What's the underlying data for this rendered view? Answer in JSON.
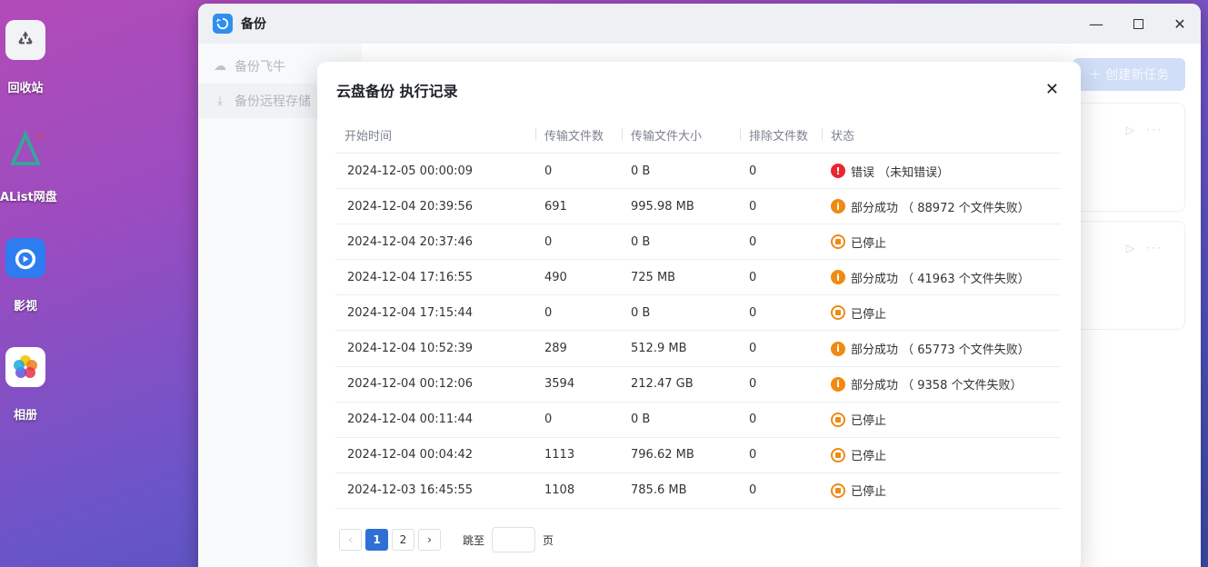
{
  "desktop": {
    "icons": [
      {
        "label": "回收站",
        "icon": "recycle-bin-icon"
      },
      {
        "label": "AList网盘",
        "icon": "alist-icon"
      },
      {
        "label": "影视",
        "icon": "video-icon"
      },
      {
        "label": "相册",
        "icon": "photos-icon"
      }
    ]
  },
  "window": {
    "title": "备份",
    "sidebar": [
      {
        "label": "备份飞牛",
        "icon": "cloud-upload-icon"
      },
      {
        "label": "备份远程存储",
        "icon": "download-icon"
      }
    ],
    "create_button": "＋ 创建新任务"
  },
  "modal": {
    "title": "云盘备份 执行记录",
    "columns": [
      "开始时间",
      "传输文件数",
      "传输文件大小",
      "排除文件数",
      "状态"
    ],
    "rows": [
      {
        "time": "2024-12-05 00:00:09",
        "count": "0",
        "size": "0 B",
        "excluded": "0",
        "status": "错误 （未知错误）",
        "kind": "error"
      },
      {
        "time": "2024-12-04 20:39:56",
        "count": "691",
        "size": "995.98 MB",
        "excluded": "0",
        "status": "部分成功 （ 88972 个文件失败）",
        "kind": "partial"
      },
      {
        "time": "2024-12-04 20:37:46",
        "count": "0",
        "size": "0 B",
        "excluded": "0",
        "status": "已停止",
        "kind": "stopped"
      },
      {
        "time": "2024-12-04 17:16:55",
        "count": "490",
        "size": "725 MB",
        "excluded": "0",
        "status": "部分成功 （ 41963 个文件失败）",
        "kind": "partial"
      },
      {
        "time": "2024-12-04 17:15:44",
        "count": "0",
        "size": "0 B",
        "excluded": "0",
        "status": "已停止",
        "kind": "stopped"
      },
      {
        "time": "2024-12-04 10:52:39",
        "count": "289",
        "size": "512.9 MB",
        "excluded": "0",
        "status": "部分成功 （ 65773 个文件失败）",
        "kind": "partial"
      },
      {
        "time": "2024-12-04 00:12:06",
        "count": "3594",
        "size": "212.47 GB",
        "excluded": "0",
        "status": "部分成功 （ 9358 个文件失败）",
        "kind": "partial"
      },
      {
        "time": "2024-12-04 00:11:44",
        "count": "0",
        "size": "0 B",
        "excluded": "0",
        "status": "已停止",
        "kind": "stopped"
      },
      {
        "time": "2024-12-04 00:04:42",
        "count": "1113",
        "size": "796.62 MB",
        "excluded": "0",
        "status": "已停止",
        "kind": "stopped"
      },
      {
        "time": "2024-12-03 16:45:55",
        "count": "1108",
        "size": "785.6 MB",
        "excluded": "0",
        "status": "已停止",
        "kind": "stopped"
      }
    ],
    "pagination": {
      "prev": "‹",
      "pages": [
        "1",
        "2"
      ],
      "current": "1",
      "next": "›",
      "jump_label": "跳至",
      "jump_value": "",
      "page_suffix": "页"
    }
  },
  "colors": {
    "primary": "#2f6fd6",
    "error": "#e8262e",
    "warning": "#f08a12"
  }
}
